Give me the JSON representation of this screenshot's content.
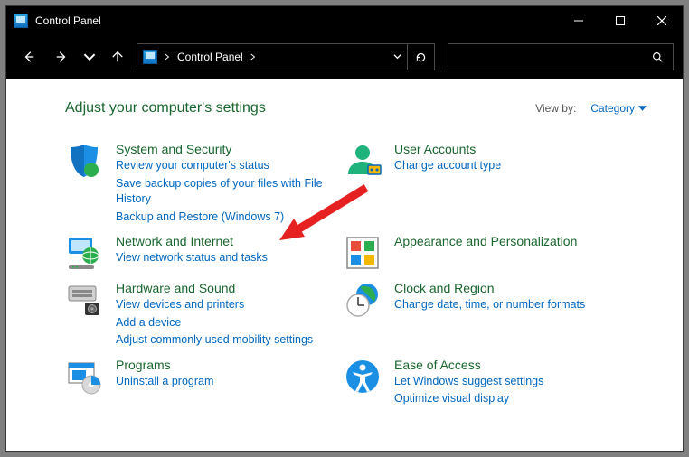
{
  "titlebar": {
    "title": "Control Panel"
  },
  "breadcrumb": {
    "root": "Control Panel"
  },
  "heading": "Adjust your computer's settings",
  "viewby": {
    "label": "View by:",
    "value": "Category"
  },
  "categories": {
    "system": {
      "title": "System and Security",
      "links": [
        "Review your computer's status",
        "Save backup copies of your files with File History",
        "Backup and Restore (Windows 7)"
      ]
    },
    "network": {
      "title": "Network and Internet",
      "links": [
        "View network status and tasks"
      ]
    },
    "hardware": {
      "title": "Hardware and Sound",
      "links": [
        "View devices and printers",
        "Add a device",
        "Adjust commonly used mobility settings"
      ]
    },
    "programs": {
      "title": "Programs",
      "links": [
        "Uninstall a program"
      ]
    },
    "user": {
      "title": "User Accounts",
      "links": [
        "Change account type"
      ]
    },
    "appearance": {
      "title": "Appearance and Personalization",
      "links": []
    },
    "clock": {
      "title": "Clock and Region",
      "links": [
        "Change date, time, or number formats"
      ]
    },
    "ease": {
      "title": "Ease of Access",
      "links": [
        "Let Windows suggest settings",
        "Optimize visual display"
      ]
    }
  }
}
